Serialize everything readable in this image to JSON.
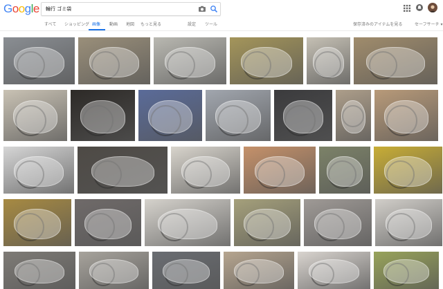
{
  "header": {
    "logo_letters": [
      {
        "ch": "G",
        "color": "#4285F4"
      },
      {
        "ch": "o",
        "color": "#EA4335"
      },
      {
        "ch": "o",
        "color": "#FBBC05"
      },
      {
        "ch": "g",
        "color": "#4285F4"
      },
      {
        "ch": "l",
        "color": "#34A853"
      },
      {
        "ch": "e",
        "color": "#EA4335"
      }
    ],
    "search_query": "輪行 ゴミ袋",
    "camera_icon": "camera-icon",
    "search_icon": "search-icon",
    "apps_icon": "apps-grid-icon",
    "notifications_icon": "bell-icon"
  },
  "tabs": {
    "items": [
      {
        "label": "すべて",
        "active": false
      },
      {
        "label": "ショッピング",
        "active": false
      },
      {
        "label": "画像",
        "active": true
      },
      {
        "label": "動画",
        "active": false
      },
      {
        "label": "地図",
        "active": false
      },
      {
        "label": "もっと見る",
        "active": false
      }
    ],
    "settings_label": "設定",
    "tools_label": "ツール",
    "safe_search_info": "保存済みのアイテムを見る",
    "safe_search_label": "セーフサーチ ▾"
  },
  "colors": {
    "accent": "#1a73e8",
    "tab_text": "#777777"
  },
  "image_results": [
    {
      "row": 0,
      "color": "#8a8e93"
    },
    {
      "row": 0,
      "color": "#9a8f7a"
    },
    {
      "row": 0,
      "color": "#b9b8b1"
    },
    {
      "row": 0,
      "color": "#a4955a"
    },
    {
      "row": 0,
      "color": "#c5c0b4"
    },
    {
      "row": 0,
      "color": "#a08c6c"
    },
    {
      "row": 1,
      "color": "#c9c2b4"
    },
    {
      "row": 1,
      "color": "#2d2a27"
    },
    {
      "row": 1,
      "color": "#5a6b99"
    },
    {
      "row": 1,
      "color": "#a1a6ae"
    },
    {
      "row": 1,
      "color": "#3b3b3d"
    },
    {
      "row": 1,
      "color": "#ad9e8a"
    },
    {
      "row": 1,
      "color": "#b89a79"
    },
    {
      "row": 2,
      "color": "#d6d6d6"
    },
    {
      "row": 2,
      "color": "#4e4a45"
    },
    {
      "row": 2,
      "color": "#d8d4cc"
    },
    {
      "row": 2,
      "color": "#c5916a"
    },
    {
      "row": 2,
      "color": "#7c8268"
    },
    {
      "row": 2,
      "color": "#c8ad35"
    },
    {
      "row": 3,
      "color": "#a78a42"
    },
    {
      "row": 3,
      "color": "#6f6a69"
    },
    {
      "row": 3,
      "color": "#d5d2cc"
    },
    {
      "row": 3,
      "color": "#a5a07b"
    },
    {
      "row": 3,
      "color": "#9f9a96"
    },
    {
      "row": 3,
      "color": "#d1cec9"
    },
    {
      "row": 4,
      "color": "#7e7b76"
    },
    {
      "row": 4,
      "color": "#a7a39c"
    },
    {
      "row": 4,
      "color": "#6a6d72"
    },
    {
      "row": 4,
      "color": "#b6a58f"
    },
    {
      "row": 4,
      "color": "#d9d4cf"
    },
    {
      "row": 4,
      "color": "#98a35a"
    }
  ]
}
